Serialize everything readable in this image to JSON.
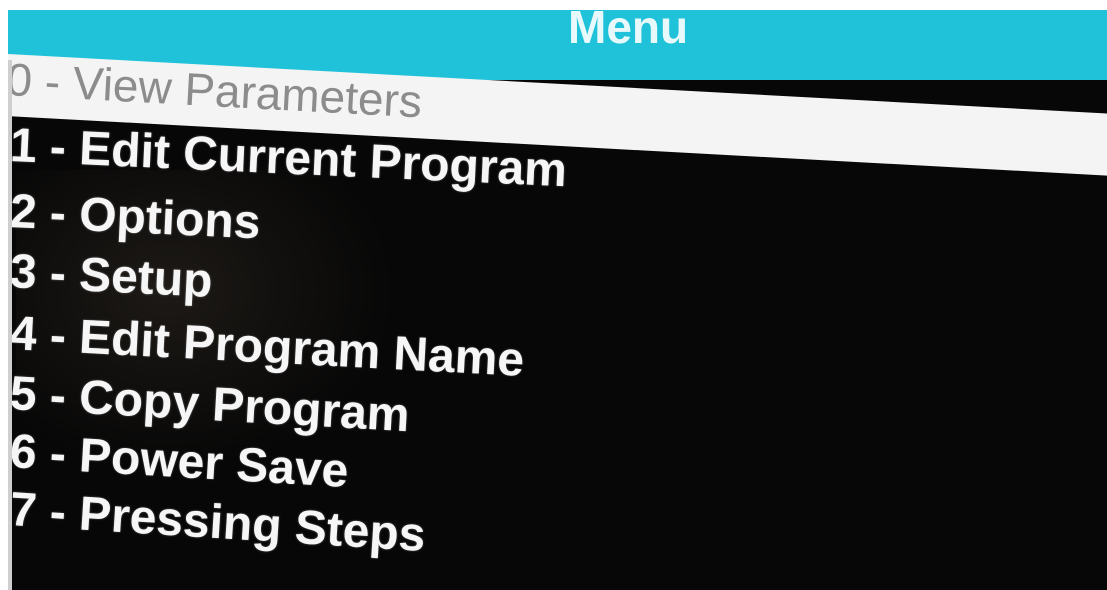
{
  "header": {
    "title": "Menu"
  },
  "menu": {
    "selected": "0 - View Parameters",
    "items": [
      "1 - Edit Current Program",
      "2 - Options",
      "3 - Setup",
      "4 - Edit Program Name",
      "5 - Copy Program",
      "6 - Power Save",
      "7 - Pressing Steps"
    ]
  },
  "colors": {
    "header_bg": "#1fc2d9",
    "screen_bg": "#070707",
    "selected_bg": "#f4f4f4",
    "selected_text": "#8c8c8c",
    "item_text": "#f6f6f6"
  }
}
